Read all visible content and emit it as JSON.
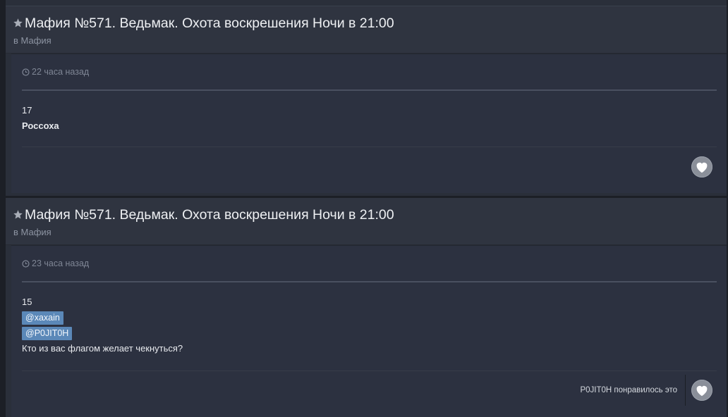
{
  "posts": [
    {
      "title": "Мафия №571. Ведьмак. Охота воскрешения Ночи в 21:00",
      "forum": "в Мафия",
      "time": "22 часа назад",
      "number": "17",
      "bold_text": "Россоха"
    },
    {
      "title": "Мафия №571. Ведьмак. Охота воскрешения Ночи в 21:00",
      "forum": "в Мафия",
      "time": "23 часа назад",
      "number": "15",
      "mentions": [
        "@xaxain",
        "@P0JIT0H"
      ],
      "text": "Кто из вас флагом желает чекнуться?",
      "liked_by": "P0JIT0H понравилось это"
    }
  ],
  "icons": {
    "star": "star-icon",
    "clock": "clock-icon",
    "heart": "heart-icon"
  },
  "colors": {
    "background": "#1c1f26",
    "card": "#2a2f3a",
    "mention_bg": "#5b88b8",
    "like_button": "#8a8f99"
  }
}
